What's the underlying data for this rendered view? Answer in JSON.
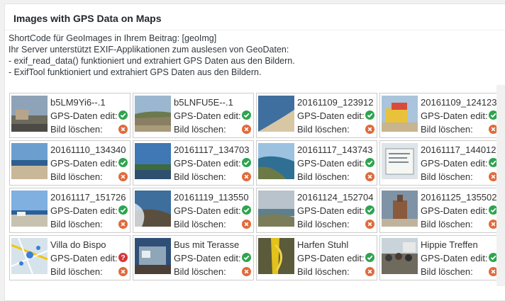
{
  "panel": {
    "title": "Images with GPS Data on Maps"
  },
  "info": {
    "line1": "ShortCode für GeoImages in Ihrem Beitrag: [geoImg]",
    "line2": "Ihr Server unterstützt EXIF-Applikationen zum auslesen von GeoDaten:",
    "line3": "- exif_read_data() funktioniert und extrahiert GPS Daten aus den Bildern.",
    "line4": "- ExifTool funktioniert und extrahiert GPS Daten aus den Bildern."
  },
  "labels": {
    "gps_edit": "GPS-Daten edit:",
    "delete": "Bild löschen:"
  },
  "colors": {
    "ok_green": "#2ea44f",
    "missing_red": "#d63638",
    "delete_orange": "#e06a3b"
  },
  "images": [
    {
      "name": "b5LM9Yi6--.1",
      "gps_status": "ok",
      "gps_icon": "check-circle-icon",
      "delete_icon": "delete-x-icon"
    },
    {
      "name": "b5LNFU5E--.1",
      "gps_status": "ok",
      "gps_icon": "check-circle-icon",
      "delete_icon": "delete-x-icon"
    },
    {
      "name": "20161109_123912",
      "gps_status": "ok",
      "gps_icon": "check-circle-icon",
      "delete_icon": "delete-x-icon"
    },
    {
      "name": "20161109_124123",
      "gps_status": "ok",
      "gps_icon": "check-circle-icon",
      "delete_icon": "delete-x-icon"
    },
    {
      "name": "20161110_134340",
      "gps_status": "ok",
      "gps_icon": "check-circle-icon",
      "delete_icon": "delete-x-icon"
    },
    {
      "name": "20161117_134703",
      "gps_status": "ok",
      "gps_icon": "check-circle-icon",
      "delete_icon": "delete-x-icon"
    },
    {
      "name": "20161117_143743",
      "gps_status": "ok",
      "gps_icon": "check-circle-icon",
      "delete_icon": "delete-x-icon"
    },
    {
      "name": "20161117_144012",
      "gps_status": "ok",
      "gps_icon": "check-circle-icon",
      "delete_icon": "delete-x-icon"
    },
    {
      "name": "20161117_151726",
      "gps_status": "ok",
      "gps_icon": "check-circle-icon",
      "delete_icon": "delete-x-icon"
    },
    {
      "name": "20161119_113550",
      "gps_status": "ok",
      "gps_icon": "check-circle-icon",
      "delete_icon": "delete-x-icon"
    },
    {
      "name": "20161124_152704",
      "gps_status": "ok",
      "gps_icon": "check-circle-icon",
      "delete_icon": "delete-x-icon"
    },
    {
      "name": "20161125_135502",
      "gps_status": "ok",
      "gps_icon": "check-circle-icon",
      "delete_icon": "delete-x-icon"
    },
    {
      "name": "Villa do Bispo",
      "gps_status": "missing",
      "gps_icon": "question-circle-icon",
      "delete_icon": "delete-x-icon"
    },
    {
      "name": "Bus mit Terasse",
      "gps_status": "ok",
      "gps_icon": "check-circle-icon",
      "delete_icon": "delete-x-icon"
    },
    {
      "name": "Harfen Stuhl",
      "gps_status": "ok",
      "gps_icon": "check-circle-icon",
      "delete_icon": "delete-x-icon"
    },
    {
      "name": "Hippie Treffen",
      "gps_status": "ok",
      "gps_icon": "check-circle-icon",
      "delete_icon": "delete-x-icon"
    }
  ]
}
